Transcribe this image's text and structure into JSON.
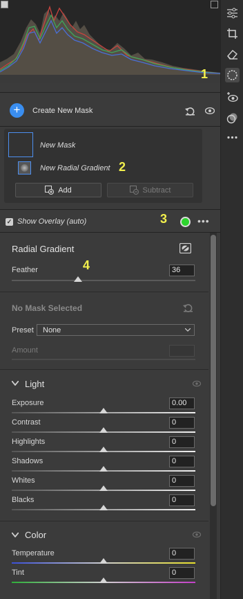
{
  "annotations": [
    "1",
    "2",
    "3",
    "4"
  ],
  "mask_header": {
    "add_symbol": "+",
    "title": "Create New Mask"
  },
  "masks": {
    "mask_name": "New Mask",
    "component_name": "New Radial Gradient",
    "add_label": "Add",
    "subtract_label": "Subtract"
  },
  "overlay": {
    "checkbox": "✓",
    "label": "Show Overlay (auto)",
    "more": "•••",
    "color": "#2ed42e"
  },
  "radial": {
    "title": "Radial Gradient",
    "feather_label": "Feather",
    "feather_value": "36",
    "feather_percent": 36
  },
  "no_mask": {
    "title": "No Mask Selected",
    "preset_label": "Preset",
    "preset_value": "None",
    "amount_label": "Amount",
    "amount_value": ""
  },
  "light": {
    "title": "Light",
    "rows": [
      {
        "label": "Exposure",
        "value": "0.00"
      },
      {
        "label": "Contrast",
        "value": "0"
      },
      {
        "label": "Highlights",
        "value": "0"
      },
      {
        "label": "Shadows",
        "value": "0"
      },
      {
        "label": "Whites",
        "value": "0"
      },
      {
        "label": "Blacks",
        "value": "0"
      }
    ]
  },
  "color": {
    "title": "Color",
    "rows": [
      {
        "label": "Temperature",
        "value": "0"
      },
      {
        "label": "Tint",
        "value": "0"
      }
    ]
  },
  "rail_tools": [
    "sliders-icon",
    "crop-icon",
    "eraser-icon",
    "masking-icon",
    "redeye-icon",
    "presets-icon",
    "more-icon"
  ]
}
